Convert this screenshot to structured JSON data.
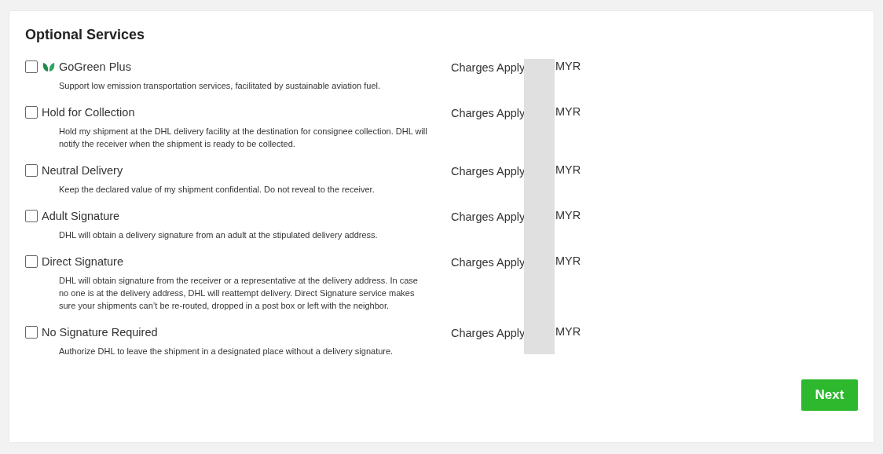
{
  "heading": "Optional Services",
  "services": [
    {
      "kind": "eco",
      "title": "GoGreen Plus",
      "checked": false,
      "description": "Support low emission transportation services, facilitated by sustainable aviation fuel.",
      "charges": "Charges Apply",
      "currency": "MYR"
    },
    {
      "kind": "standard",
      "title": "Hold for Collection",
      "checked": false,
      "description": "Hold my shipment at the DHL delivery facility at the destination for consignee collection. DHL will notify the receiver when the shipment is ready to be collected.",
      "charges": "Charges Apply",
      "currency": "MYR"
    },
    {
      "kind": "standard",
      "title": "Neutral Delivery",
      "checked": false,
      "description": "Keep the declared value of my shipment confidential. Do not reveal to the receiver.",
      "charges": "Charges Apply",
      "currency": "MYR"
    },
    {
      "kind": "standard",
      "title": "Adult Signature",
      "checked": false,
      "description": "DHL will obtain a delivery signature from an adult at the stipulated delivery address.",
      "charges": "Charges Apply",
      "currency": "MYR"
    },
    {
      "kind": "standard",
      "title": "Direct Signature",
      "checked": false,
      "description": "DHL will obtain signature from the receiver or a representative at the delivery address. In case no one is at the delivery address, DHL will reattempt delivery. Direct Signature service makes sure your shipments can’t be re-routed, dropped in a post box or left with the neighbor.",
      "charges": "Charges Apply",
      "currency": "MYR"
    },
    {
      "kind": "standard",
      "title": "No Signature Required",
      "checked": false,
      "description": "Authorize DHL to leave the shipment in a designated place without a delivery signature.",
      "charges": "Charges Apply",
      "currency": "MYR"
    }
  ],
  "next_button": "Next"
}
